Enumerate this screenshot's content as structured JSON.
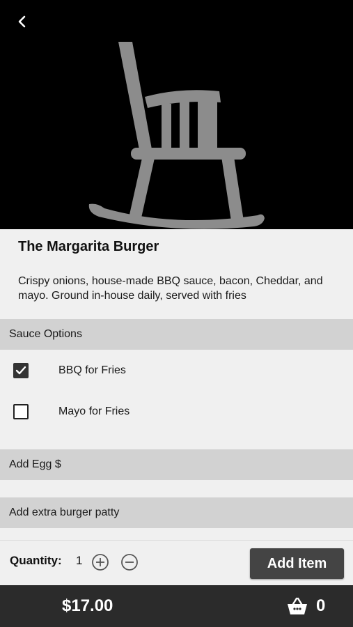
{
  "product": {
    "title": "The Margarita Burger",
    "description": "Crispy onions, house-made BBQ sauce, bacon, Cheddar, and mayo. Ground in-house daily, served with fries",
    "image_icon": "rocking-chair-icon"
  },
  "sauce_options": {
    "header": "Sauce Options",
    "items": [
      {
        "label": "BBQ for Fries",
        "checked": true
      },
      {
        "label": "Mayo for Fries",
        "checked": false
      }
    ]
  },
  "add_egg": {
    "header": "Add Egg $"
  },
  "add_patty": {
    "header": "Add extra burger patty"
  },
  "quantity": {
    "label": "Quantity:",
    "value": "1"
  },
  "actions": {
    "add_item_label": "Add Item"
  },
  "footer": {
    "price": "$17.00",
    "cart_count": "0"
  },
  "colors": {
    "hero_bg": "#000000",
    "section_header_bg": "#d2d2d2",
    "button_bg": "#444444",
    "footer_bg": "#2b2b2b"
  }
}
